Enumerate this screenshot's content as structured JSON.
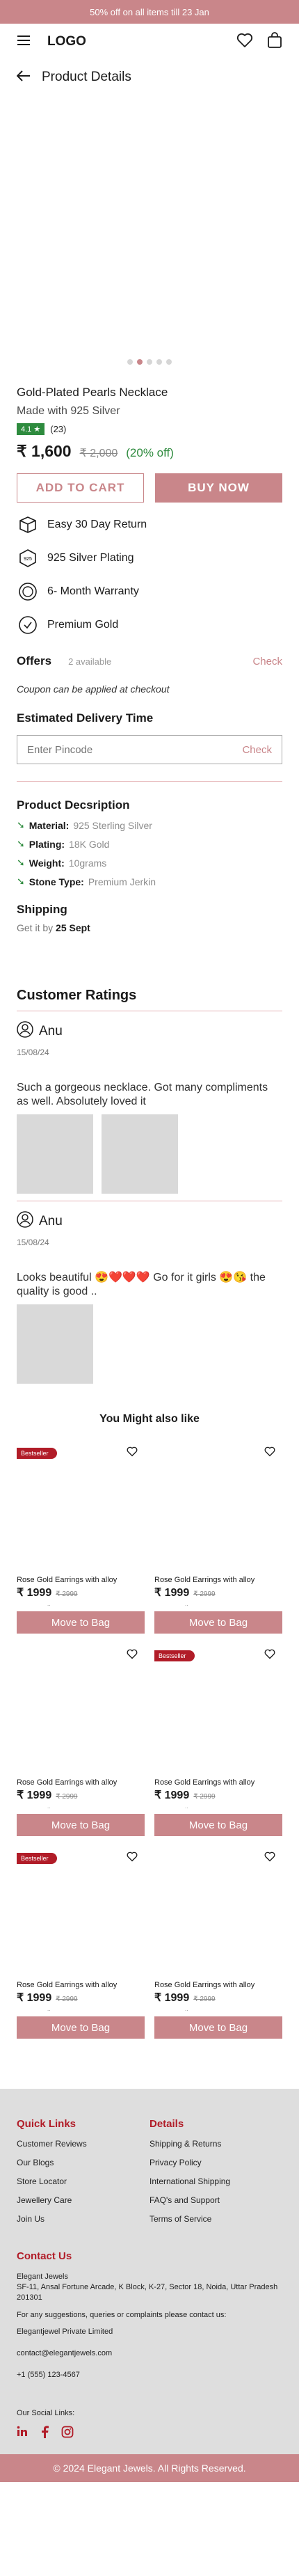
{
  "announcement": "50% off on all items till 23 Jan",
  "header": {
    "logo": "LOGO",
    "page_title": "Product Details"
  },
  "gallery": {
    "slides": 5,
    "active_index": 1
  },
  "product": {
    "title": "Gold-Plated Pearls Necklace",
    "subtitle": "Made with 925 Silver",
    "rating": "4.1",
    "rating_count": "(23)",
    "price": "₹ 1,600",
    "mrp": "₹ 2,000",
    "discount": "(20% off)",
    "add_to_cart": "ADD TO CART",
    "buy_now": "BUY NOW"
  },
  "features": [
    {
      "icon": "return-box-icon",
      "label": "Easy 30 Day Return"
    },
    {
      "icon": "silver-925-icon",
      "label": "925 Silver Plating"
    },
    {
      "icon": "warranty-badge-icon",
      "label": "6- Month Warranty"
    },
    {
      "icon": "gold-coin-icon",
      "label": "Premium Gold"
    }
  ],
  "offers": {
    "title": "Offers",
    "available": "2 available",
    "check": "Check",
    "coupon_note": "Coupon can be applied at checkout"
  },
  "delivery": {
    "title": "Estimated Delivery Time",
    "placeholder": "Enter Pincode",
    "check": "Check"
  },
  "description": {
    "title": "Product Decsription",
    "items": [
      {
        "key": "Material:",
        "value": "925 Sterling Silver"
      },
      {
        "key": "Plating:",
        "value": "18K Gold"
      },
      {
        "key": "Weight:",
        "value": "10grams"
      },
      {
        "key": "Stone Type:",
        "value": "Premium Jerkin"
      }
    ]
  },
  "shipping": {
    "title": "Shipping",
    "prefix": "Get it by",
    "date": "25 Sept"
  },
  "ratings": {
    "title": "Customer Ratings",
    "reviews": [
      {
        "user": "Anu",
        "date": "15/08/24",
        "text": "Such a gorgeous necklace. Got many compliments as well. Absolutely loved it"
      },
      {
        "user": "Anu",
        "date": "15/08/24",
        "text": "Looks beautiful 😍❤️❤️❤️ Go for it girls 😍😘 the quality is good .."
      }
    ]
  },
  "recommend": {
    "title": "You Might also like",
    "cards": [
      {
        "badge": "Bestseller",
        "name": "Rose Gold Earrings with alloy",
        "price": "₹ 1999",
        "mrp": "₹ 2999",
        "note": "..",
        "button": "Move to Bag"
      },
      {
        "badge": "",
        "name": "Rose Gold Earrings with alloy",
        "price": "₹ 1999",
        "mrp": "₹ 2999",
        "note": "..",
        "button": "Move to Bag"
      },
      {
        "badge": "",
        "name": "Rose Gold Earrings with alloy",
        "price": "₹ 1999",
        "mrp": "₹ 2999",
        "note": "..",
        "button": "Move to Bag"
      },
      {
        "badge": "Bestseller",
        "name": "Rose Gold Earrings with alloy",
        "price": "₹ 1999",
        "mrp": "₹ 2999",
        "note": "..",
        "button": "Move to Bag"
      },
      {
        "badge": "Bestseller",
        "name": "Rose Gold Earrings with alloy",
        "price": "₹ 1999",
        "mrp": "₹ 2999",
        "note": "..",
        "button": "Move to Bag"
      },
      {
        "badge": "",
        "name": "Rose Gold Earrings with alloy",
        "price": "₹ 1999",
        "mrp": "₹ 2999",
        "note": "..",
        "button": "Move to Bag"
      }
    ]
  },
  "footer": {
    "quick_links": {
      "title": "Quick Links",
      "items": [
        "Customer Reviews",
        "Our Blogs",
        "Store Locator",
        "Jewellery Care",
        "Join Us"
      ]
    },
    "details": {
      "title": "Details",
      "items": [
        "Shipping & Returns",
        "Privacy Policy",
        "International Shipping",
        "FAQ's and Support",
        "Terms of Service"
      ]
    },
    "contact": {
      "title": "Contact Us",
      "address_name": "Elegant Jewels",
      "address": "SF-11, Ansal Fortune Arcade, K Block, K-27, Sector 18, Noida, Uttar Pradesh 201301",
      "note": "For any suggestions, queries or complaints please contact us:",
      "company": "Elegantjewel Private Limited",
      "email": "contact@elegantjewels.com",
      "phone": "+1 (555) 123-4567"
    },
    "social_title": "Our Social Links:",
    "social_icons": [
      "linkedin-icon",
      "facebook-icon",
      "instagram-icon"
    ],
    "copyright": "© 2024 Elegant Jewels. All Rights Reserved."
  },
  "colors": {
    "accent": "#c9868a",
    "brand_red": "#b11c28",
    "success": "#2e8b3e"
  }
}
